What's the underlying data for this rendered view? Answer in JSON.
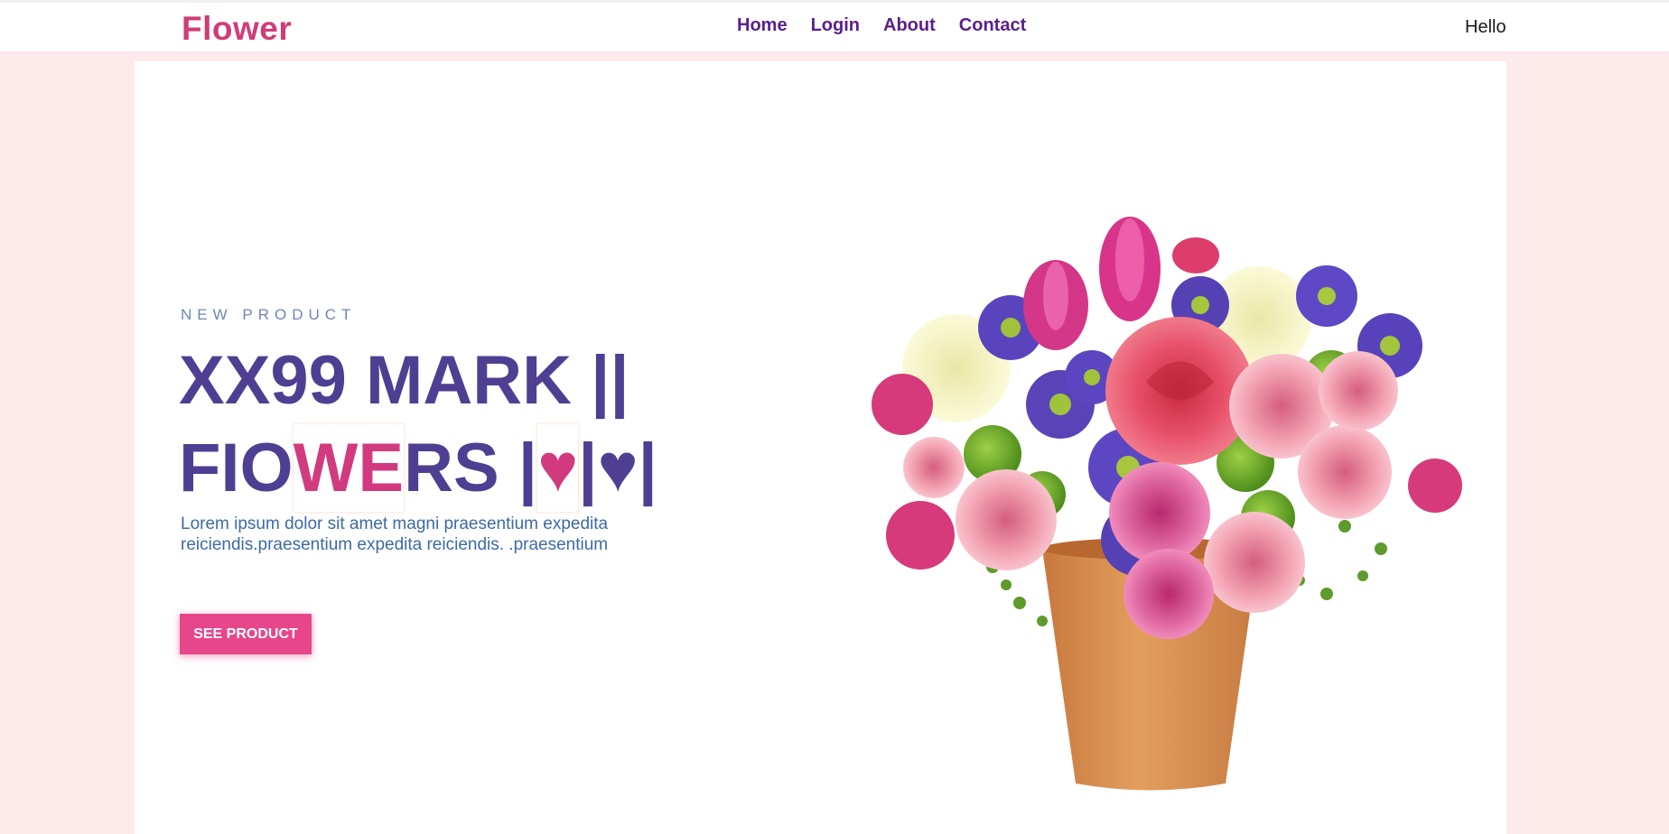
{
  "header": {
    "logo": "Flower",
    "nav": [
      {
        "label": "Home"
      },
      {
        "label": "Login"
      },
      {
        "label": "About"
      },
      {
        "label": "Contact"
      }
    ],
    "greeting": "Hello"
  },
  "hero": {
    "eyebrow": "NEW PRODUCT",
    "headline_line1": "XX99 MARK ||",
    "headline_line2_a": "FIO",
    "headline_line2_b": "WE",
    "headline_line2_c": "RS |",
    "headline_heart1": "♥",
    "headline_line2_d": "|♥|",
    "description": "Lorem ipsum dolor sit amet magni praesentium expedita reiciendis.praesentium expedita reiciendis. .praesentium",
    "cta_label": "SEE PRODUCT"
  },
  "colors": {
    "brand_pink": "#d03c78",
    "nav_purple": "#5a1e8c",
    "headline_purple": "#4f3f92",
    "page_bg": "#fdeaea",
    "button_pink": "#e8468b"
  },
  "image": {
    "subject": "flower-bouquet-in-terracotta-pot"
  }
}
